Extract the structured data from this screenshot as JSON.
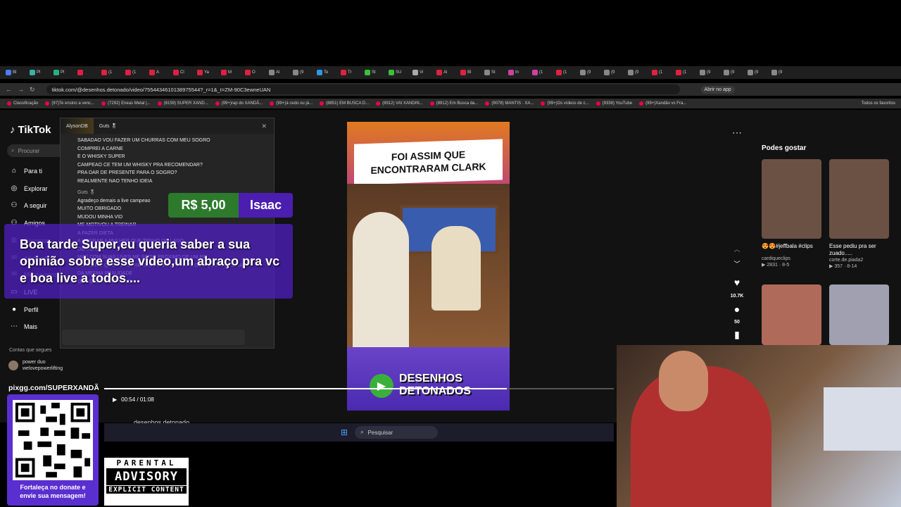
{
  "browser": {
    "tabs": [
      "Bl",
      "Pl",
      "Pl",
      "",
      "(1",
      "(1",
      "A",
      "Cl",
      "Ya",
      "M",
      "O",
      "Al",
      "(9",
      "Te",
      "Tr",
      "St",
      "SU",
      "Vi",
      "Al",
      "Bl",
      "St",
      "In",
      "(1",
      "(1",
      "(9",
      "(9",
      "(9",
      "(1",
      "(1",
      "(9",
      "(9",
      "(9",
      "(9"
    ],
    "url": "tiktok.com/@desenhos.detonado/video/7554434610138975544?_r=1&_t=ZM-90C3ewneUAN",
    "abrir_app": "Abrir no app",
    "bookmarks": [
      "Classificação",
      "(97)Te ensino a venc...",
      "(7292) Eneas Metal |...",
      "(8159) SUPER XAND...",
      "(99+)rap do XANDÃ...",
      "(99+)á cedo ou já...",
      "(8851) EM BUSCA D...",
      "(8912) VAI XANDIN...",
      "(8912) Em Busca da...",
      "(9078) MANTIS · XA...",
      "(99+)Os vídeos de c...",
      "(9338) YouTube",
      "(99+)Xandão vs Fra..."
    ],
    "todos_favoritos": "Todos os favoritos",
    "nav_back": "←",
    "nav_forward": "→",
    "nav_reload": "↻"
  },
  "tiktok": {
    "logo": "TikTok",
    "search_placeholder": "Procurar",
    "nav": [
      "Para ti",
      "Explorar",
      "A seguir",
      "Amigos",
      "Carregar",
      "Atividade",
      "Mensagens",
      "LIVE",
      "Perfil",
      "Mais"
    ],
    "following_header": "Contas que segues",
    "following": [
      "power duo",
      "welovepowerlifting"
    ],
    "video": {
      "banner": "FOI ASSIM QUE ENCONTRARAM CLARK",
      "brand_line1": "DESENHOS",
      "brand_line2": "DETONADOS",
      "time": "00:54 / 01:08",
      "likes": "10.7K",
      "comments": "50",
      "progress": 0.79
    },
    "author": "desenhos.detonado",
    "right_panel": {
      "title": "Podes gostar",
      "items": [
        {
          "caption": "😍😍#jeffbala #clips",
          "user": "cardiqueclips",
          "stats": "▶ 2831 · 8-5"
        },
        {
          "caption": "Esse pediu pra ser zuado.....",
          "user": "corte.de.piada2",
          "stats": "▶ 357 · 8-14"
        }
      ]
    }
  },
  "chat": {
    "tabs": [
      "AlysonDB",
      "Guts 🎖",
      ""
    ],
    "messages": [
      "SABADAO VOU FAZER UM CHURRAS COM MEU SOGRO",
      "COMPREI A CARNE",
      "E O WHISKY SUPER",
      "CAMPEAO CE TEM UM WHISKY PRA RECOMENDAR?",
      "PRA DAR DE PRESENTE PARA O SOGRO?",
      "REALMENTE NAO TENHO IDEIA"
    ],
    "author2": "Guts 🎖",
    "messages2": [
      "Agradeço demais a live campeao",
      "MUITO OBRIGADO",
      "MUDOU MINHA VID",
      "ME MOTIVOU A TREINAR",
      "A FAZER DIETA",
      "A HONRAR A MULHER QUE TENHO DO LADO",
      "OBRIGADO",
      "MAS COM SUAS LIVES ME SINTO PROXIMO DE UM PAI",
      "ACREDITO QUE TU SUPRE ESSE PAPEL PARA TODOS QUE PARTILHAM",
      "DA MESMA REALIDADE",
      "OBRIGADO POR TUDO"
    ]
  },
  "donation": {
    "amount": "R$ 5,00",
    "name": "Isaac",
    "message": "Boa tarde Super,eu queria saber a sua opinião sobre esse vídeo,um abraço pra vc e boa live a todos...."
  },
  "taskbar": {
    "search": "Pesquisar"
  },
  "stream": {
    "pix_url": "pixgg.com/SUPERXANDÃO",
    "qr_caption_line1": "Fortaleça no donate e",
    "qr_caption_line2": "envie sua mensagem!",
    "parental_1": "PARENTAL",
    "parental_2": "ADVISORY",
    "parental_3": "EXPLICIT CONTENT"
  },
  "colors": {
    "donation_green": "#2d7a2d",
    "donation_purple": "#4b1eb0",
    "tiktok_bg": "#121212"
  }
}
